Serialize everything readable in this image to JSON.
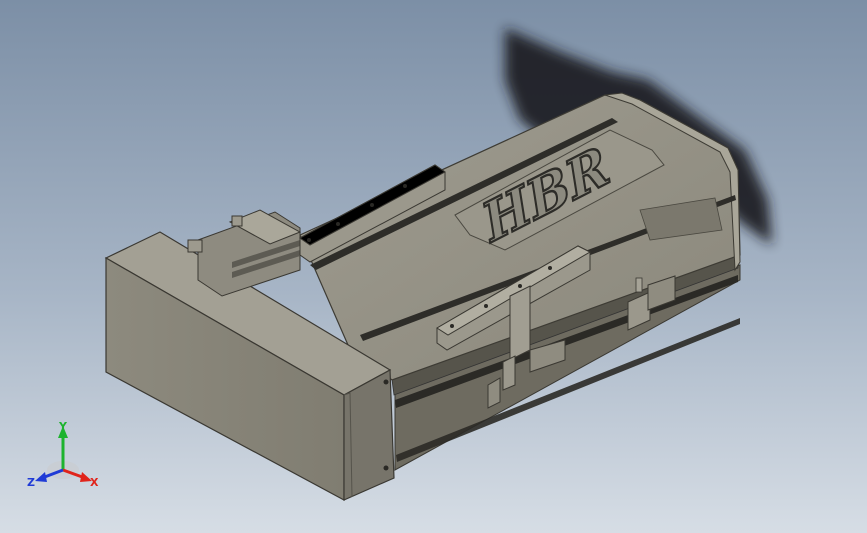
{
  "viewport": {
    "background_top": "#7c8fa6",
    "background_bottom": "#d6dde5"
  },
  "model": {
    "logo_text": "HBR",
    "body_color": "#8f8c80",
    "shadow_color": "#1c1f24"
  },
  "triad": {
    "x_label": "X",
    "y_label": "Y",
    "z_label": "Z",
    "x_color": "#e0241b",
    "y_color": "#1db32e",
    "z_color": "#1f3bd6"
  }
}
